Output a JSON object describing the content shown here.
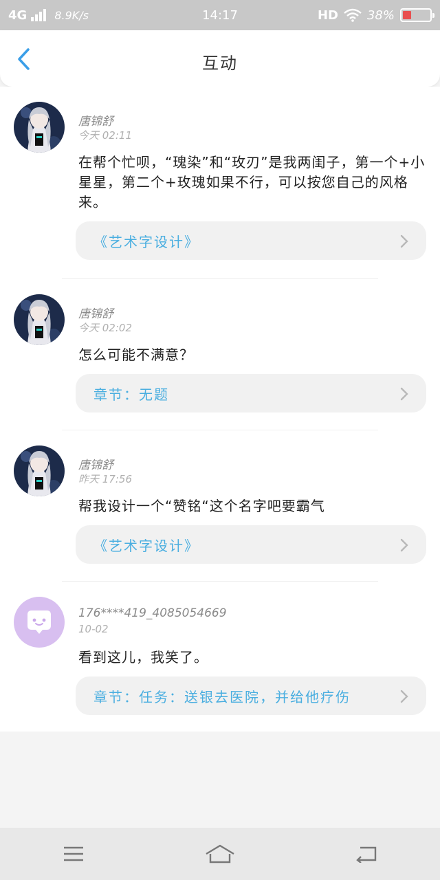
{
  "status_bar": {
    "network": "4G",
    "speed": "8.9K/s",
    "time": "14:17",
    "hd": "HD",
    "battery": "38%"
  },
  "header": {
    "title": "互动",
    "back_icon": "chevron-left-icon"
  },
  "comments": [
    {
      "user": "唐锦舒",
      "time": "今天 02:11",
      "text": "在帮个忙呗，“瑰染”和“玫刃”是我两闺子，第一个+小星星，第二个+玫瑰如果不行，可以按您自己的风格来。",
      "link": "《艺术字设计》",
      "avatar": "anime-avatar"
    },
    {
      "user": "唐锦舒",
      "time": "今天 02:02",
      "text": "怎么可能不满意？",
      "link": "章节：无题",
      "avatar": "anime-avatar"
    },
    {
      "user": "唐锦舒",
      "time": "昨天 17:56",
      "text": "帮我设计一个“赞铭“这个名字吧要霸气",
      "link": "《艺术字设计》",
      "avatar": "anime-avatar"
    },
    {
      "user": "176****419_4085054669",
      "time": "10-02",
      "text": "看到这儿，我笑了。",
      "link": "章节：任务：送银去医院，并给他疗伤",
      "avatar": "chat-bubble-avatar"
    }
  ],
  "colors": {
    "accent": "#4aaee0",
    "back_arrow": "#3a9ee8",
    "default_avatar_bg": "#d8bff0"
  },
  "nav": {
    "menu_icon": "menu-icon",
    "home_icon": "home-icon",
    "back_icon": "back-icon"
  }
}
